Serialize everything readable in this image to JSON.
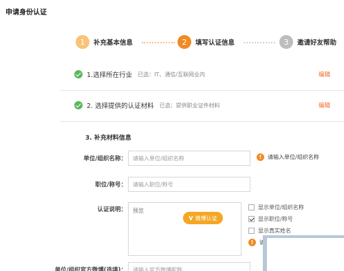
{
  "page": {
    "title": "申请身份认证"
  },
  "steps": [
    {
      "num": "1",
      "label": "补充基本信息",
      "color": "#f8c37a"
    },
    {
      "num": "2",
      "label": "填写认证信息",
      "color": "#f08a24"
    },
    {
      "num": "3",
      "label": "邀请好友帮助",
      "color": "#bdbdbd"
    }
  ],
  "sections": {
    "industry": {
      "title": "1.选择所在行业",
      "summary": "已选：IT、通信/互联网业内",
      "edit": "编辑"
    },
    "materials": {
      "title": "2. 选择提供的认证材料",
      "summary": "已选：提供职业证件材料",
      "edit": "编辑"
    },
    "supplement": {
      "title": "3. 补充材料信息"
    }
  },
  "form": {
    "unit_name": {
      "label": "单位/组织名称：",
      "placeholder": "请输入单位/组织名称",
      "hint": "请输入单位/组织名称"
    },
    "position": {
      "label": "职位/称号：",
      "placeholder": "请输入职位/称号"
    },
    "description": {
      "label": "认证说明：",
      "placeholder": "预览"
    },
    "weibo_button": "微博认证",
    "options": [
      {
        "label": "显示单位/组织名称",
        "checked": false
      },
      {
        "label": "显示职位/称号",
        "checked": true
      },
      {
        "label": "显示真实姓名",
        "checked": false
      }
    ],
    "option_hint": "请",
    "official_weibo": {
      "label": "单位/组织官方微博(选填)：",
      "placeholder": "请输入官方微博昵称"
    }
  },
  "colors": {
    "accent": "#f08a24",
    "success": "#5cb85c",
    "edit_link": "#f06a28"
  }
}
